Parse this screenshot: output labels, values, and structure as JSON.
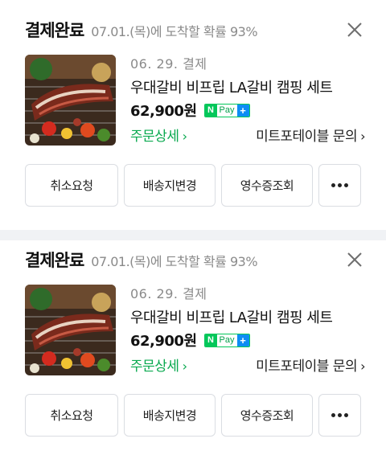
{
  "orders": [
    {
      "status": "결제완료",
      "eta": "07.01.(목)에 도착할 확률 93%",
      "order_date": "06. 29. 결제",
      "product_name": "우대갈비 비프립 LA갈비 캠핑 세트",
      "price": "62,900원",
      "pay_badge": {
        "n": "N",
        "pay": "Pay",
        "plus": "+"
      },
      "detail_link": "주문상세",
      "seller_link": "미트포테이블 문의",
      "actions": [
        "취소요청",
        "배송지변경",
        "영수증조회"
      ],
      "thumbnail_icon": "grilled-ribs-photo"
    },
    {
      "status": "결제완료",
      "eta": "07.01.(목)에 도착할 확률 93%",
      "order_date": "06. 29. 결제",
      "product_name": "우대갈비 비프립 LA갈비 캠핑 세트",
      "price": "62,900원",
      "pay_badge": {
        "n": "N",
        "pay": "Pay",
        "plus": "+"
      },
      "detail_link": "주문상세",
      "seller_link": "미트포테이블 문의",
      "actions": [
        "취소요청",
        "배송지변경",
        "영수증조회"
      ],
      "thumbnail_icon": "grilled-ribs-photo"
    }
  ],
  "colors": {
    "accent_green": "#09a94f",
    "npay_green": "#03c75a",
    "npay_blue": "#0d8df4",
    "muted": "#8a8a8a",
    "divider": "#f0f2f5"
  }
}
